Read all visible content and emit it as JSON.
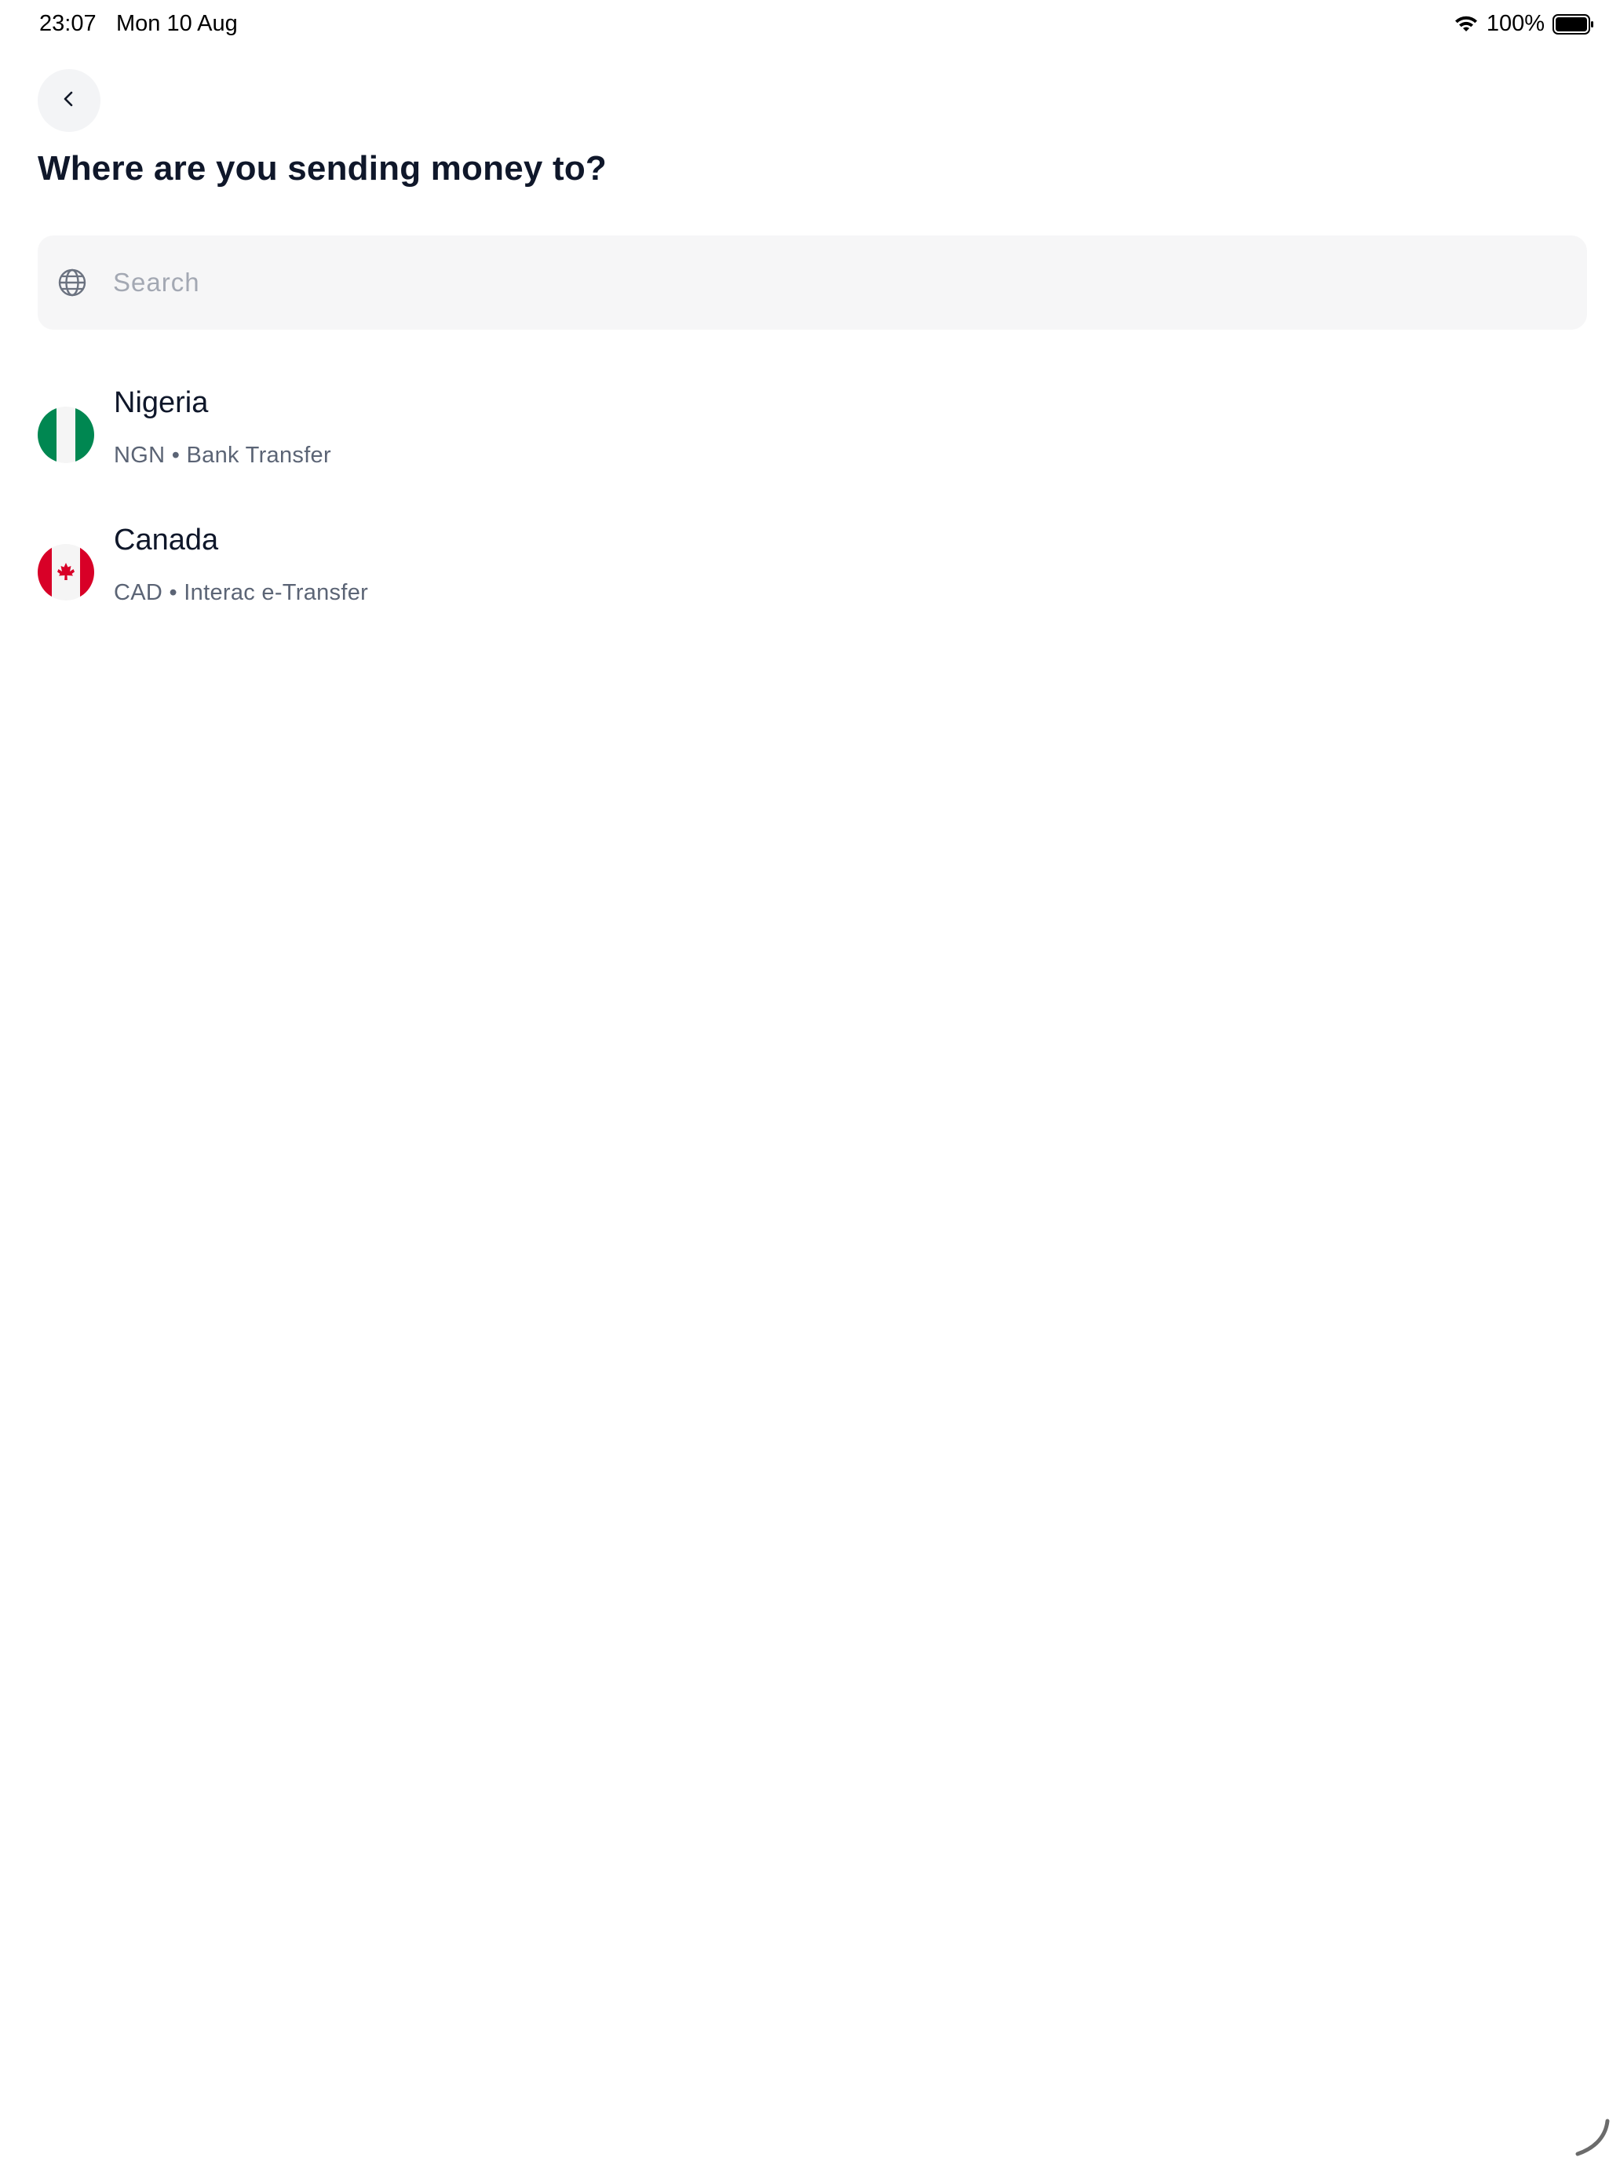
{
  "status_bar": {
    "time": "23:07",
    "date": "Mon 10 Aug",
    "battery": "100%",
    "wifi_icon": "wifi-icon",
    "battery_icon": "battery-icon"
  },
  "header": {
    "back_icon": "chevron-left-icon",
    "title": "Where are you sending money to?"
  },
  "search": {
    "placeholder": "Search",
    "value": "",
    "icon": "globe-icon"
  },
  "countries": [
    {
      "name": "Nigeria",
      "subtitle": "NGN • Bank Transfer",
      "flag_icon": "nigeria-flag-icon"
    },
    {
      "name": "Canada",
      "subtitle": "CAD • Interac e-Transfer",
      "flag_icon": "canada-flag-icon"
    }
  ],
  "colors": {
    "title": "#0f172a",
    "subtitle": "#5b6475",
    "search_bg": "#f6f6f7",
    "nigeria_green": "#008751",
    "canada_red": "#d80027"
  }
}
